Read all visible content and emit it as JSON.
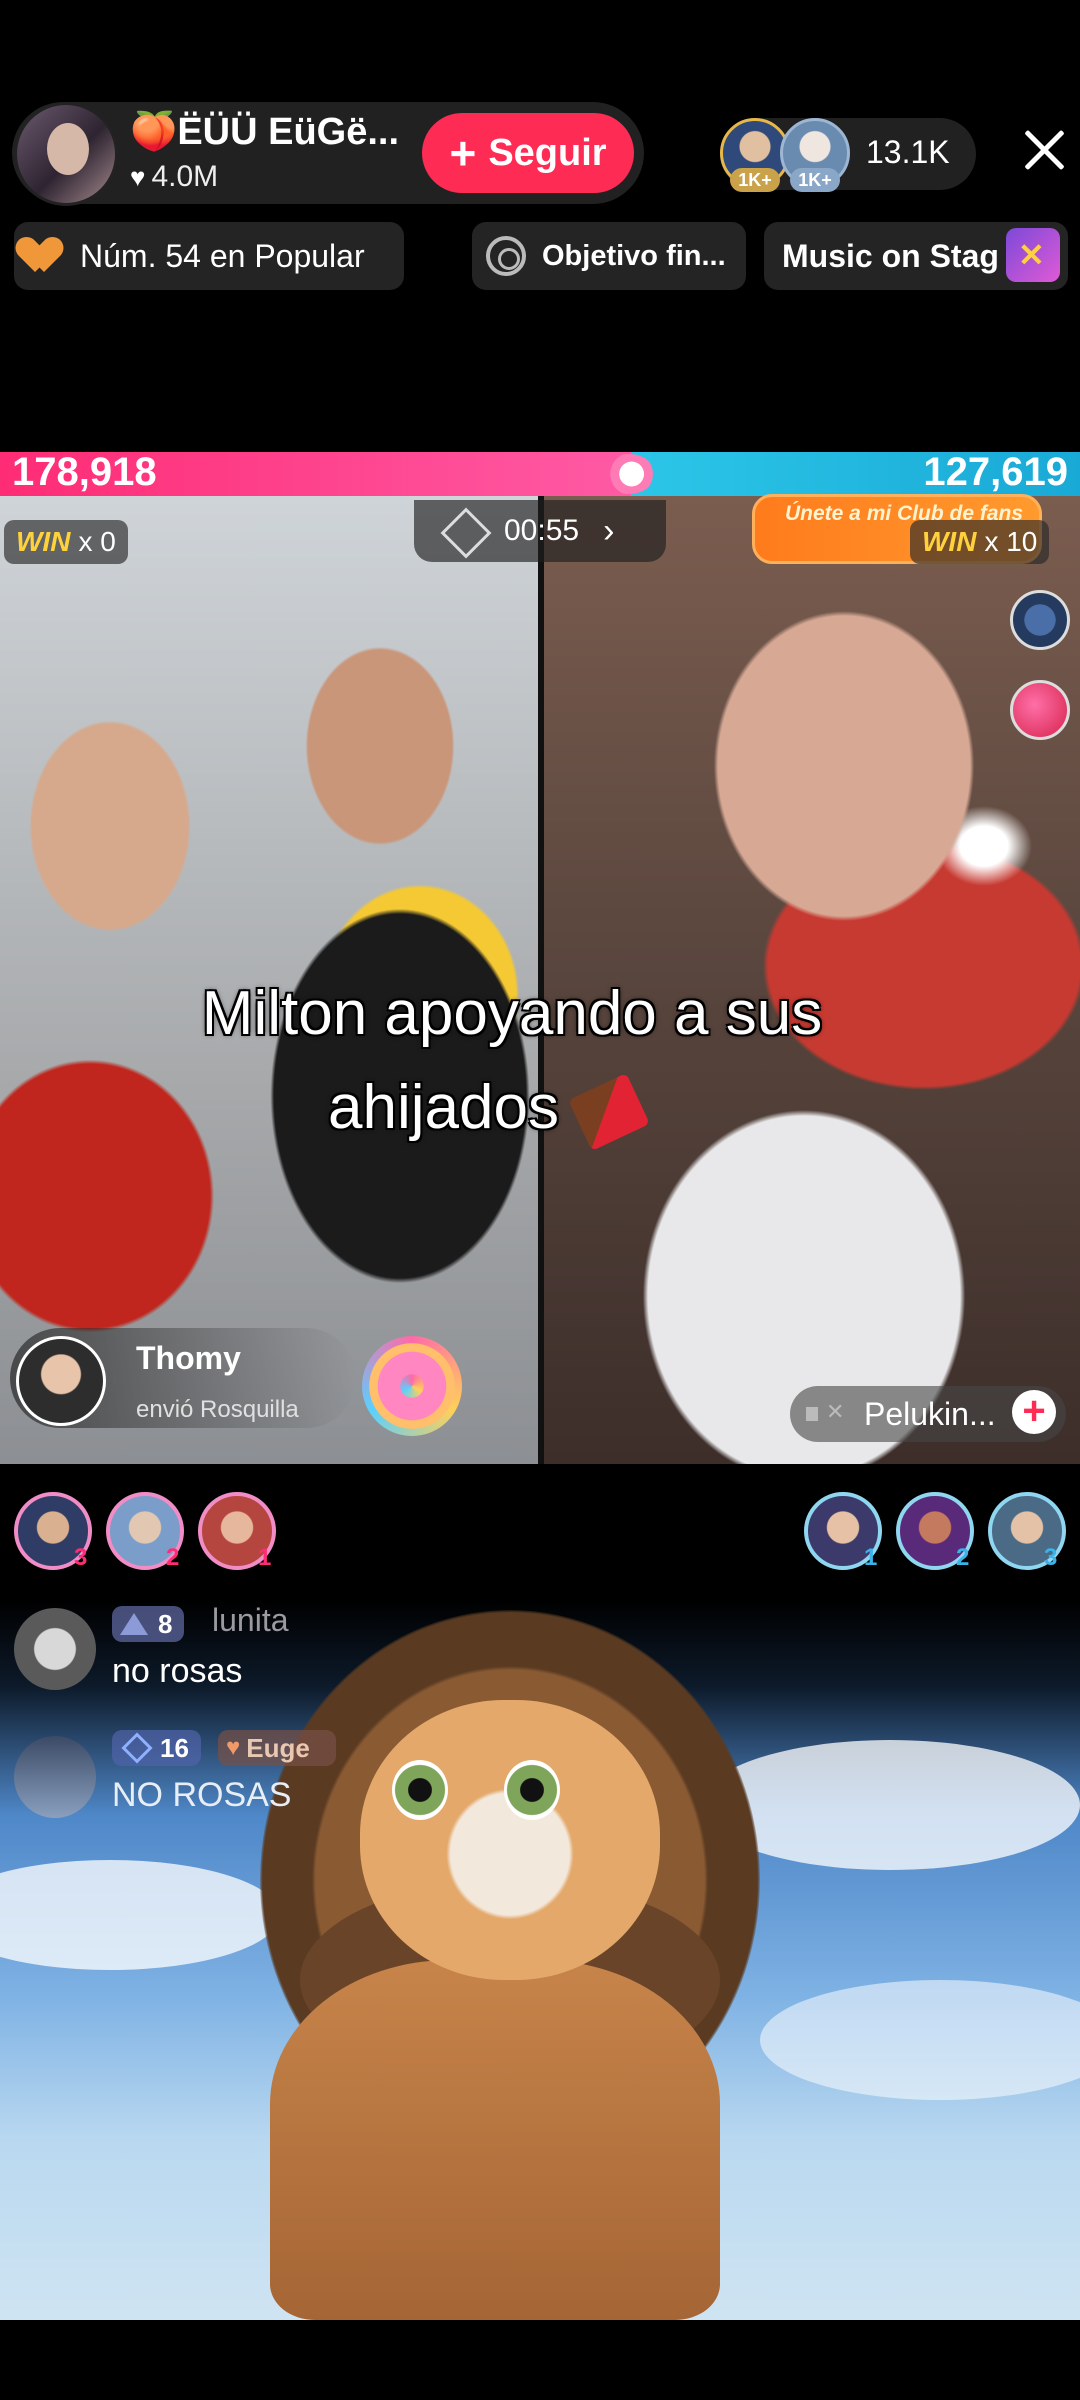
{
  "header": {
    "host_name": "🍑ËÜÜ EüGë...",
    "likes": "4.0M",
    "follow_label": "Seguir",
    "viewer_badges": [
      "1K+",
      "1K+"
    ],
    "viewer_count": "13.1K"
  },
  "chips": {
    "rank": "Núm. 54 en Popular",
    "goal": "Objetivo fin...",
    "music": "Music on Stag"
  },
  "battle": {
    "score_left": "178,918",
    "score_right": "127,619",
    "left_share": 0.584,
    "timer": "00:55",
    "win_word": "WIN",
    "win_left": "x 0",
    "win_right": "x 10",
    "fan_club": "Únete a mi Club de fans",
    "colors": {
      "left": "#fe2c75",
      "right": "#2cc6e8",
      "follow": "#fe2c55"
    }
  },
  "caption": {
    "line1": "Milton apoyando a sus",
    "line2": "ahijados"
  },
  "gift_toast": {
    "name": "Thomy",
    "action": "envió Rosquilla"
  },
  "opponent": {
    "name": "Pelukin..."
  },
  "ranks": {
    "left": [
      "3",
      "2",
      "1"
    ],
    "right": [
      "1",
      "2",
      "3"
    ]
  },
  "chat": [
    {
      "level": "8",
      "user": "lunita",
      "text": "no rosas"
    },
    {
      "level": "16",
      "fan_badge": "Euge",
      "text": "NO ROSAS"
    }
  ]
}
